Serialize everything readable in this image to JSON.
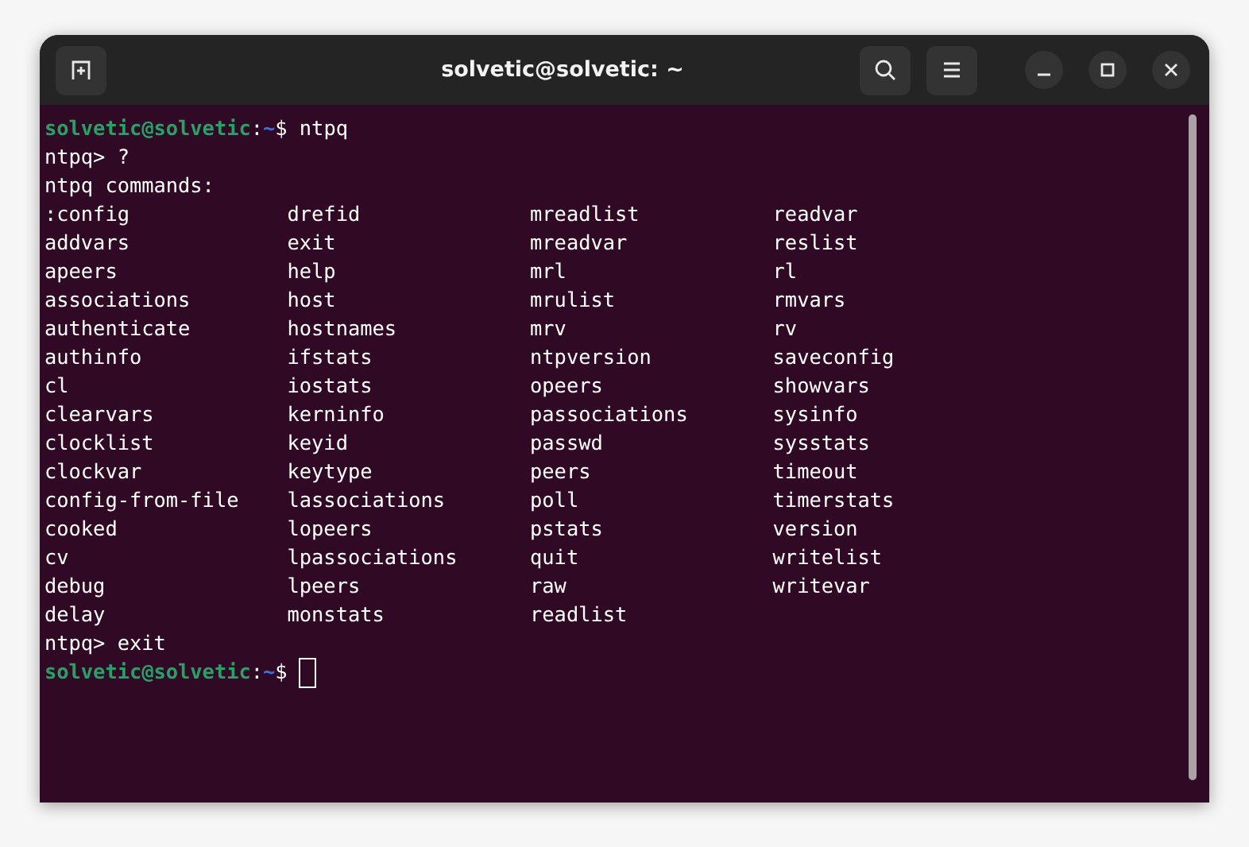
{
  "window": {
    "title": "solvetic@solvetic: ~"
  },
  "terminal": {
    "lines": [
      {
        "kind": "prompt",
        "user": "solvetic@solvetic",
        "separator": ":",
        "path": "~",
        "symbol": "$",
        "command": "ntpq",
        "cursor": false
      },
      {
        "kind": "output",
        "text": "ntpq> ?"
      },
      {
        "kind": "output",
        "text": "ntpq commands:"
      },
      {
        "kind": "columns",
        "rows": [
          [
            ":config",
            "drefid",
            "mreadlist",
            "readvar"
          ],
          [
            "addvars",
            "exit",
            "mreadvar",
            "reslist"
          ],
          [
            "apeers",
            "help",
            "mrl",
            "rl"
          ],
          [
            "associations",
            "host",
            "mrulist",
            "rmvars"
          ],
          [
            "authenticate",
            "hostnames",
            "mrv",
            "rv"
          ],
          [
            "authinfo",
            "ifstats",
            "ntpversion",
            "saveconfig"
          ],
          [
            "cl",
            "iostats",
            "opeers",
            "showvars"
          ],
          [
            "clearvars",
            "kerninfo",
            "passociations",
            "sysinfo"
          ],
          [
            "clocklist",
            "keyid",
            "passwd",
            "sysstats"
          ],
          [
            "clockvar",
            "keytype",
            "peers",
            "timeout"
          ],
          [
            "config-from-file",
            "lassociations",
            "poll",
            "timerstats"
          ],
          [
            "cooked",
            "lopeers",
            "pstats",
            "version"
          ],
          [
            "cv",
            "lpassociations",
            "quit",
            "writelist"
          ],
          [
            "debug",
            "lpeers",
            "raw",
            "writevar"
          ],
          [
            "delay",
            "monstats",
            "readlist"
          ]
        ]
      },
      {
        "kind": "output",
        "text": "ntpq> exit"
      },
      {
        "kind": "prompt",
        "user": "solvetic@solvetic",
        "separator": ":",
        "path": "~",
        "symbol": "$",
        "cursor": true
      }
    ]
  }
}
